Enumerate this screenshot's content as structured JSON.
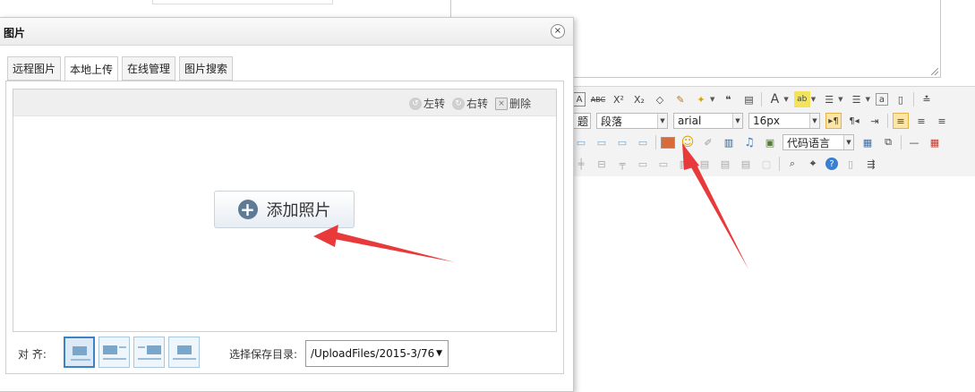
{
  "dialog": {
    "title": "图片",
    "close_glyph": "×",
    "tabs": [
      {
        "label": "远程图片"
      },
      {
        "label": "本地上传",
        "active": true
      },
      {
        "label": "在线管理"
      },
      {
        "label": "图片搜索"
      }
    ],
    "upload_bar": {
      "rotate_left": "左转",
      "rotate_right": "右转",
      "delete": "删除"
    },
    "add_photo_label": "添加照片",
    "align_label": "对 齐:",
    "align_options": [
      "none",
      "left",
      "right",
      "center"
    ],
    "save_dir_label": "选择保存目录:",
    "save_dir_value": "/UploadFiles/2015-3/76"
  },
  "toolbar": {
    "heading_combo": "题",
    "paragraph_combo": "段落",
    "font_combo": "arial",
    "size_combo": "16px",
    "code_language_combo": "代码语言"
  },
  "colors": {
    "arrow": "#e83a3a",
    "tab_border": "#cfcfcf",
    "plus_icon": "#5e7a94"
  }
}
